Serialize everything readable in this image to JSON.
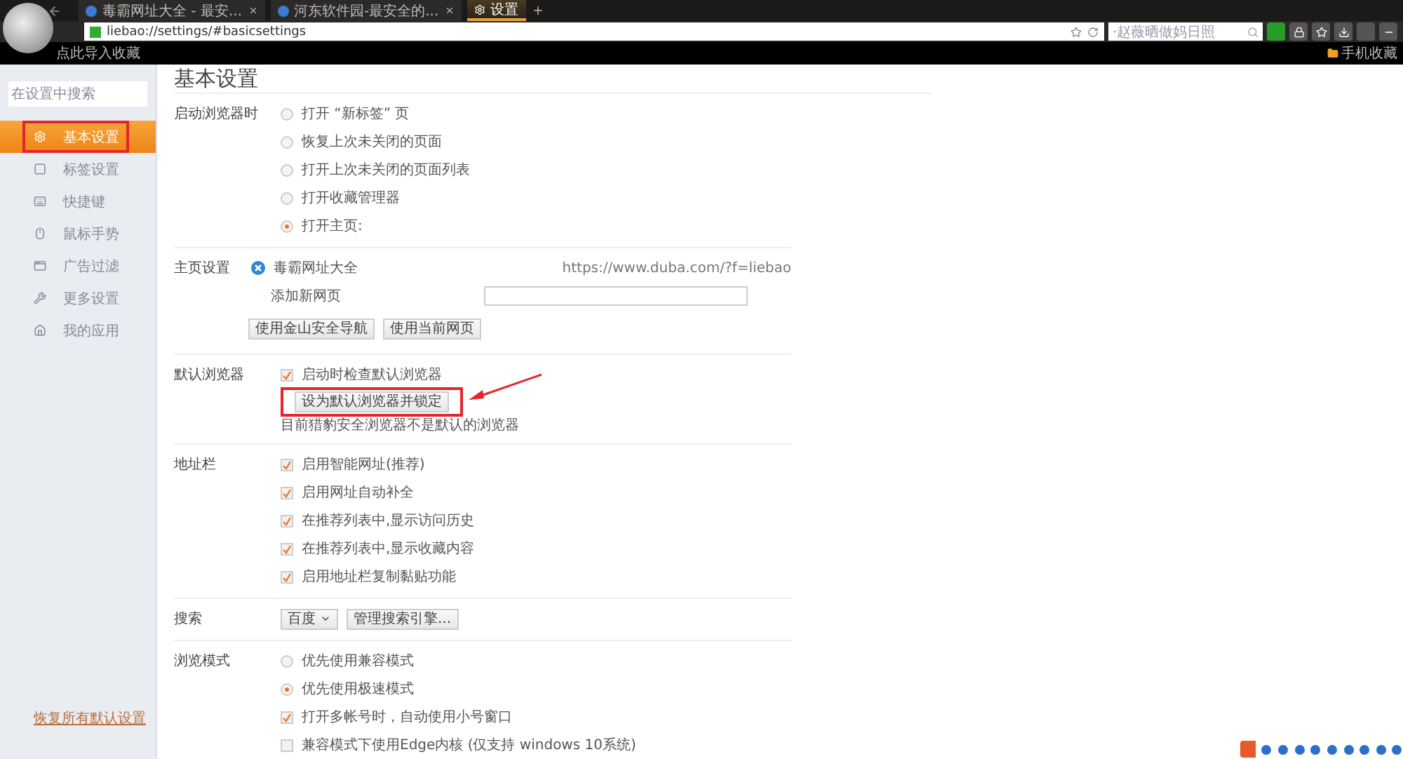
{
  "tabs": [
    {
      "label": "毒霸网址大全 - 最安...",
      "selected": false
    },
    {
      "label": "河东软件园-最安全的...",
      "selected": false
    },
    {
      "label": "设置",
      "selected": true
    }
  ],
  "address": {
    "value": "liebao://settings/#basicsettings"
  },
  "search": {
    "placeholder": "·赵薇晒做妈日照"
  },
  "bookmarks": {
    "left": "点此导入收藏",
    "right": "手机收藏"
  },
  "sidebar": {
    "search_placeholder": "在设置中搜索",
    "items": [
      {
        "label": "基本设置",
        "selected": true
      },
      {
        "label": "标签设置",
        "selected": false
      },
      {
        "label": "快捷键",
        "selected": false
      },
      {
        "label": "鼠标手势",
        "selected": false
      },
      {
        "label": "广告过滤",
        "selected": false
      },
      {
        "label": "更多设置",
        "selected": false
      },
      {
        "label": "我的应用",
        "selected": false
      }
    ],
    "reset_link": "恢复所有默认设置"
  },
  "title": "基本设置",
  "sections": [
    {
      "label": "启动浏览器时",
      "rows": [
        {
          "kind": "radio",
          "label": "打开 “新标签” 页",
          "selected": false
        },
        {
          "kind": "radio",
          "label": "恢复上次未关闭的页面",
          "selected": false
        },
        {
          "kind": "radio",
          "label": "打开上次未关闭的页面列表",
          "selected": false
        },
        {
          "kind": "radio",
          "label": "打开收藏管理器",
          "selected": false
        },
        {
          "kind": "radio",
          "label": "打开主页:",
          "selected": true
        }
      ]
    },
    {
      "label": "主页设置",
      "rows": [
        {
          "kind": "homepage",
          "label": "毒霸网址大全",
          "url": "https://www.duba.com/?f=liebao"
        },
        {
          "kind": "addpage",
          "label": "添加新网页"
        },
        {
          "kind": "buttons",
          "buttons": [
            "使用金山安全导航",
            "使用当前网页"
          ]
        }
      ]
    },
    {
      "label": "默认浏览器",
      "rows": [
        {
          "kind": "checkbox",
          "label": "启动时检查默认浏览器",
          "checked": true
        },
        {
          "kind": "buttons",
          "buttons": [
            "设为默认浏览器并锁定"
          ],
          "highlighted": true
        },
        {
          "kind": "note",
          "label": "目前猎豹安全浏览器不是默认的浏览器"
        }
      ]
    },
    {
      "label": "地址栏",
      "rows": [
        {
          "kind": "checkbox",
          "label": "启用智能网址(推荐)",
          "checked": true
        },
        {
          "kind": "checkbox",
          "label": "启用网址自动补全",
          "checked": true
        },
        {
          "kind": "checkbox",
          "label": "在推荐列表中,显示访问历史",
          "checked": true
        },
        {
          "kind": "checkbox",
          "label": "在推荐列表中,显示收藏内容",
          "checked": true
        },
        {
          "kind": "checkbox",
          "label": "启用地址栏复制黏贴功能",
          "checked": true
        }
      ]
    },
    {
      "label": "搜索",
      "rows": [
        {
          "kind": "engine",
          "value": "百度",
          "button": "管理搜索引擎..."
        }
      ]
    },
    {
      "label": "浏览模式",
      "rows": [
        {
          "kind": "radio",
          "label": "优先使用兼容模式",
          "selected": false
        },
        {
          "kind": "radio",
          "label": "优先使用极速模式",
          "selected": true
        },
        {
          "kind": "checkbox",
          "label": "打开多帐号时，自动使用小号窗口",
          "checked": true
        },
        {
          "kind": "checkbox",
          "label": "兼容模式下使用Edge内核 (仅支持 windows 10系统)",
          "checked": false
        }
      ]
    }
  ]
}
